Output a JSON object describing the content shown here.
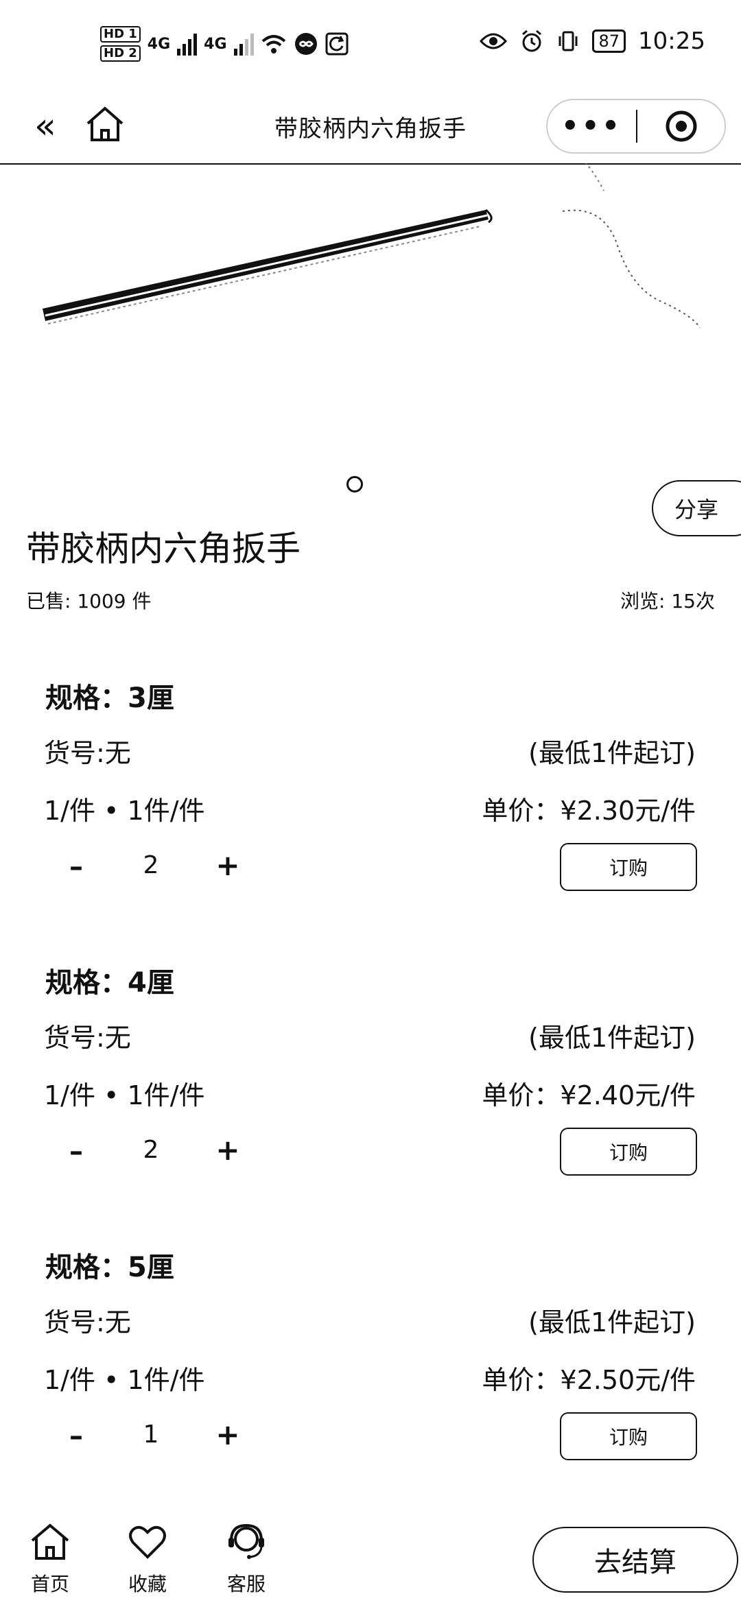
{
  "status_bar": {
    "hd1": "HD 1",
    "hd2": "HD 2",
    "net1": "4G",
    "net2": "4G",
    "battery": "87",
    "time": "10:25"
  },
  "nav": {
    "title": "带胶柄内六角扳手",
    "more": "•••"
  },
  "product": {
    "title": "带胶柄内六角扳手",
    "sold": "已售: 1009 件",
    "views": "浏览: 15次",
    "share": "分享",
    "gallery_page": 1
  },
  "variants": [
    {
      "spec": "规格：3厘",
      "code": "货号:无",
      "moq": "(最低1件起订)",
      "unit": "1/件 • 1件/件",
      "price": "单价：¥2.30元/件",
      "minus": "–",
      "qty": "2",
      "plus": "+",
      "order": "订购"
    },
    {
      "spec": "规格：4厘",
      "code": "货号:无",
      "moq": "(最低1件起订)",
      "unit": "1/件 • 1件/件",
      "price": "单价：¥2.40元/件",
      "minus": "–",
      "qty": "2",
      "plus": "+",
      "order": "订购"
    },
    {
      "spec": "规格：5厘",
      "code": "货号:无",
      "moq": "(最低1件起订)",
      "unit": "1/件 • 1件/件",
      "price": "单价：¥2.50元/件",
      "minus": "–",
      "qty": "1",
      "plus": "+",
      "order": "订购"
    }
  ],
  "tabbar": {
    "home": "首页",
    "favorite": "收藏",
    "service": "客服",
    "cart": "去结算"
  }
}
